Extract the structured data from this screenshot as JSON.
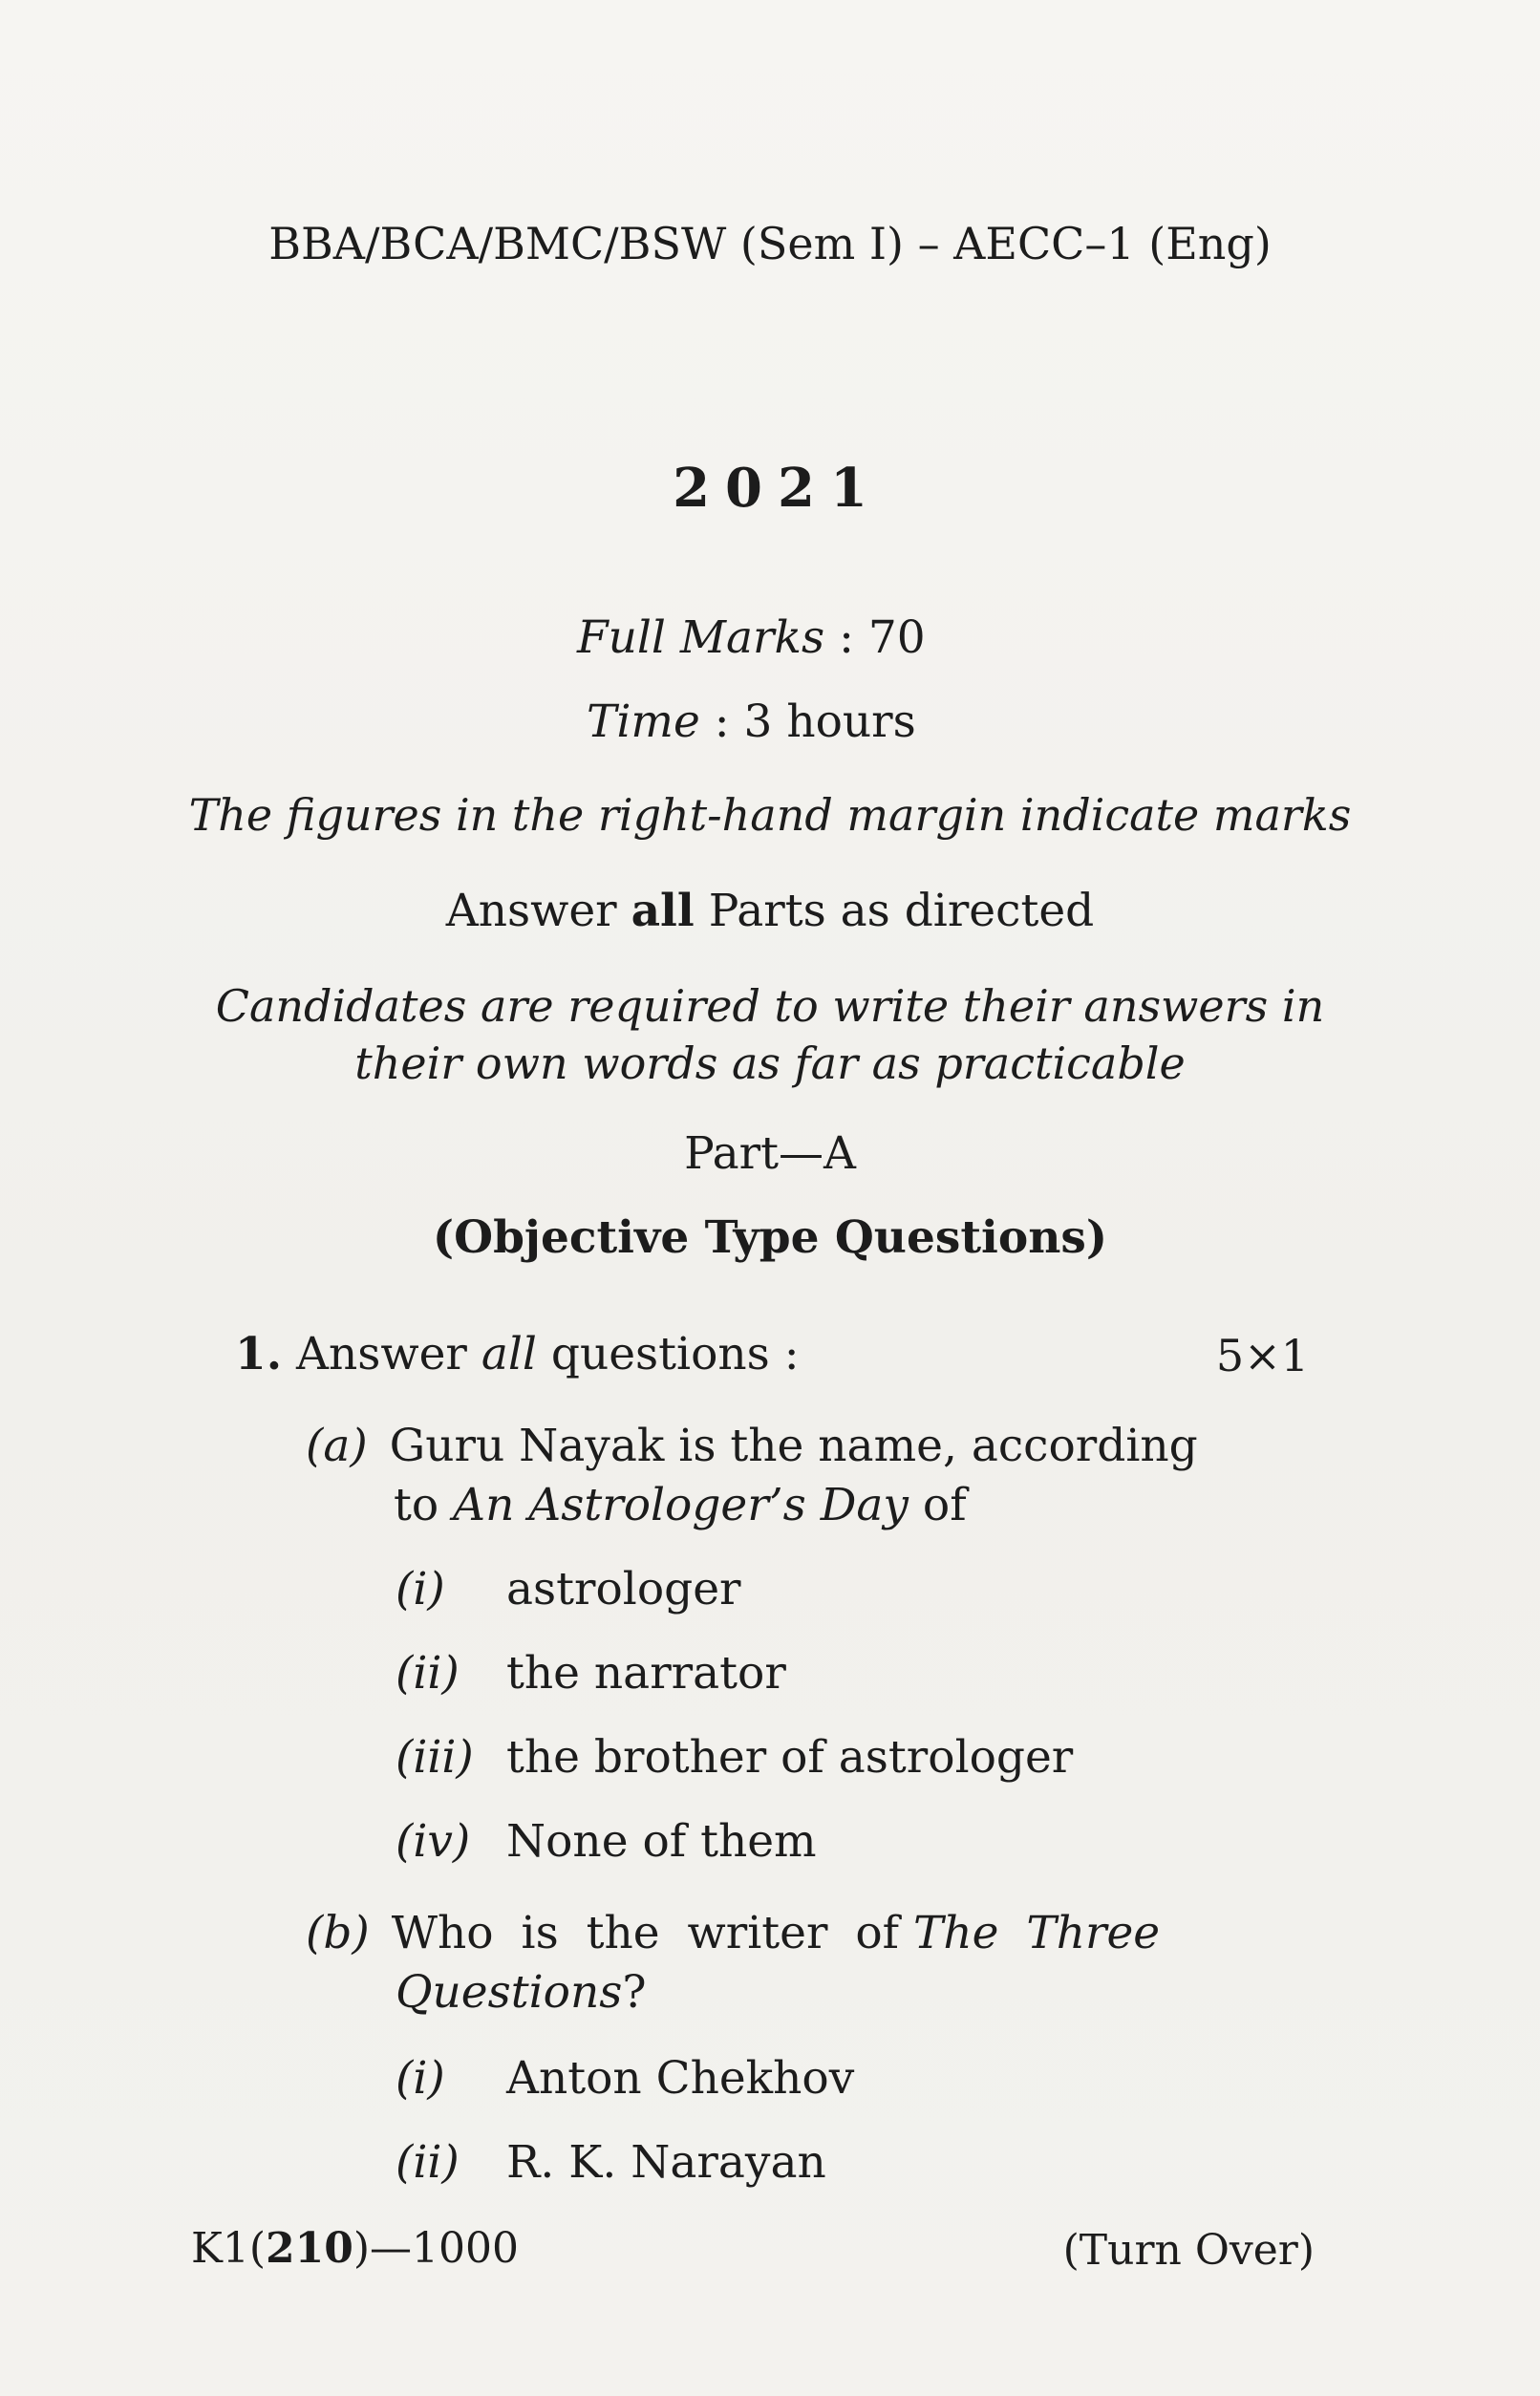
{
  "header": {
    "course": "BBA/BCA/BMC/BSW (Sem I) – AECC–1 (Eng)",
    "year": "2021",
    "full_marks_label": "Full Marks",
    "full_marks_value": ": 70",
    "time_label": "Time",
    "time_value": ": 3 hours"
  },
  "instructions": {
    "marks_note": "The figures in the right-hand margin indicate marks",
    "answer_prefix": "Answer",
    "answer_bold": "all",
    "answer_suffix": "Parts as directed",
    "candidates_line1": "Candidates are required to write their answers in",
    "candidates_line2": "their own words as far as practicable"
  },
  "part": {
    "title": "Part—A",
    "subtitle": "(Objective Type Questions)"
  },
  "question1": {
    "number": "1.",
    "text_prefix": "Answer",
    "text_italic": "all",
    "text_suffix": "questions :",
    "marks": "5×1",
    "a": {
      "label": "(a)",
      "line1": "Guru Nayak is the name, according",
      "line2_prefix": "to",
      "line2_italic": "An Astrologer’s Day",
      "line2_suffix": "of",
      "options": [
        {
          "label": "(i)",
          "text": "astrologer"
        },
        {
          "label": "(ii)",
          "text": "the narrator"
        },
        {
          "label": "(iii)",
          "text": "the brother of astrologer"
        },
        {
          "label": "(iv)",
          "text": "None of them"
        }
      ]
    },
    "b": {
      "label": "(b)",
      "line1_prefix": "Who is the writer of",
      "line1_italic": "The Three",
      "line2_italic": "Questions",
      "line2_suffix": "?",
      "options": [
        {
          "label": "(i)",
          "text": "Anton Chekhov"
        },
        {
          "label": "(ii)",
          "text": "R. K. Narayan"
        }
      ]
    }
  },
  "footer": {
    "code_prefix": "K1(",
    "code_bold": "210",
    "code_suffix": ")—1000",
    "turn_over": "(Turn Over)"
  }
}
